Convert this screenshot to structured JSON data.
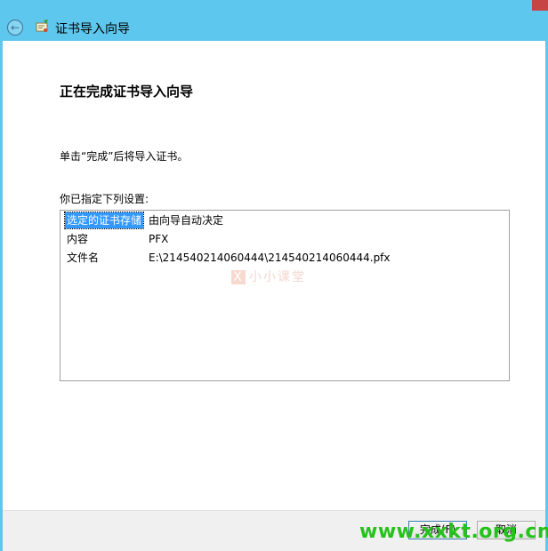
{
  "window": {
    "title": "证书导入向导"
  },
  "wizard": {
    "heading": "正在完成证书导入向导",
    "description": "单击“完成”后将导入证书。",
    "list_label": "你已指定下列设置:",
    "settings": [
      {
        "key": "选定的证书存储",
        "value": "由向导自动决定",
        "selected": true
      },
      {
        "key": "内容",
        "value": "PFX",
        "selected": false
      },
      {
        "key": "文件名",
        "value": "E:\\214540214060444\\214540214060444.pfx",
        "selected": false
      }
    ]
  },
  "footer": {
    "finish_label": "完成(F)",
    "cancel_label": "取消"
  },
  "watermarks": {
    "center": "小小课堂",
    "site": "www.xxkt.org.cn"
  },
  "colors": {
    "titlebar": "#5ec7ee",
    "selection": "#3399ff",
    "site_watermark": "#25c21b"
  },
  "icons": {
    "back": "back-arrow-icon",
    "wizard": "certificate-wizard-icon"
  }
}
